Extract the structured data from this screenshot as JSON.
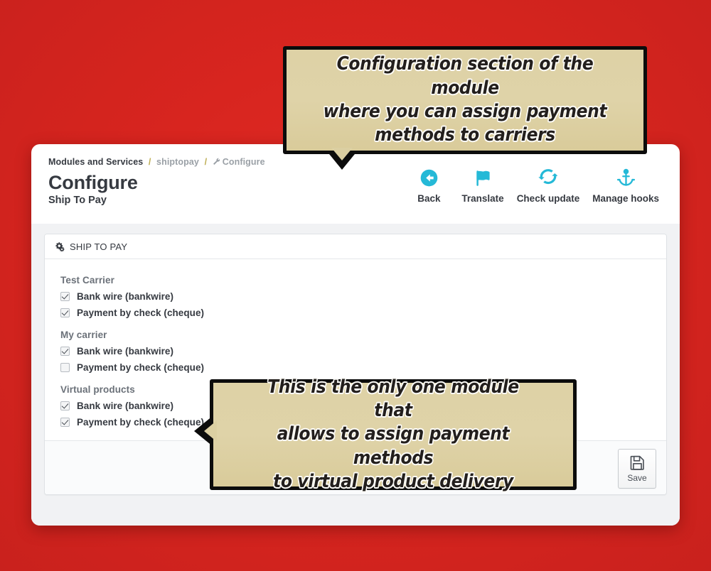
{
  "breadcrumb": {
    "root": "Modules and Services",
    "module": "shiptopay",
    "current": "Configure",
    "separator": "/",
    "current_icon": "wrench-icon"
  },
  "header": {
    "title": "Configure",
    "subtitle": "Ship To Pay"
  },
  "toolbar": {
    "items": [
      {
        "label": "Back",
        "icon": "arrow-left-circle-icon"
      },
      {
        "label": "Translate",
        "icon": "flag-icon"
      },
      {
        "label": "Check update",
        "icon": "refresh-icon"
      },
      {
        "label": "Manage hooks",
        "icon": "anchor-icon"
      }
    ],
    "accent_color": "#25b9d7"
  },
  "panel": {
    "title": "SHIP TO PAY",
    "icon": "cogs-icon",
    "groups": [
      {
        "title": "Test Carrier",
        "options": [
          {
            "label": "Bank wire (bankwire)",
            "checked": true
          },
          {
            "label": "Payment by check (cheque)",
            "checked": true
          }
        ]
      },
      {
        "title": "My carrier",
        "options": [
          {
            "label": "Bank wire (bankwire)",
            "checked": true
          },
          {
            "label": "Payment by check (cheque)",
            "checked": false
          }
        ]
      },
      {
        "title": "Virtual products",
        "options": [
          {
            "label": "Bank wire (bankwire)",
            "checked": true
          },
          {
            "label": "Payment by check (cheque)",
            "checked": true
          }
        ]
      }
    ]
  },
  "save": {
    "label": "Save",
    "icon": "floppy-disk-icon"
  },
  "callouts": {
    "top": {
      "lines": [
        "Configuration section of the module",
        "where you can assign payment",
        "methods to carriers"
      ],
      "tail": "down"
    },
    "bottom": {
      "lines": [
        "This is the only one module that",
        "allows to assign payment methods",
        "to virtual product delivery"
      ],
      "tail": "left"
    }
  },
  "colors": {
    "background_red": "#d8251f",
    "callout_fill": "#dcd0a4",
    "callout_border": "#0c0c0c",
    "accent_cyan": "#25b9d7",
    "breadcrumb_sep": "#bdad52"
  }
}
